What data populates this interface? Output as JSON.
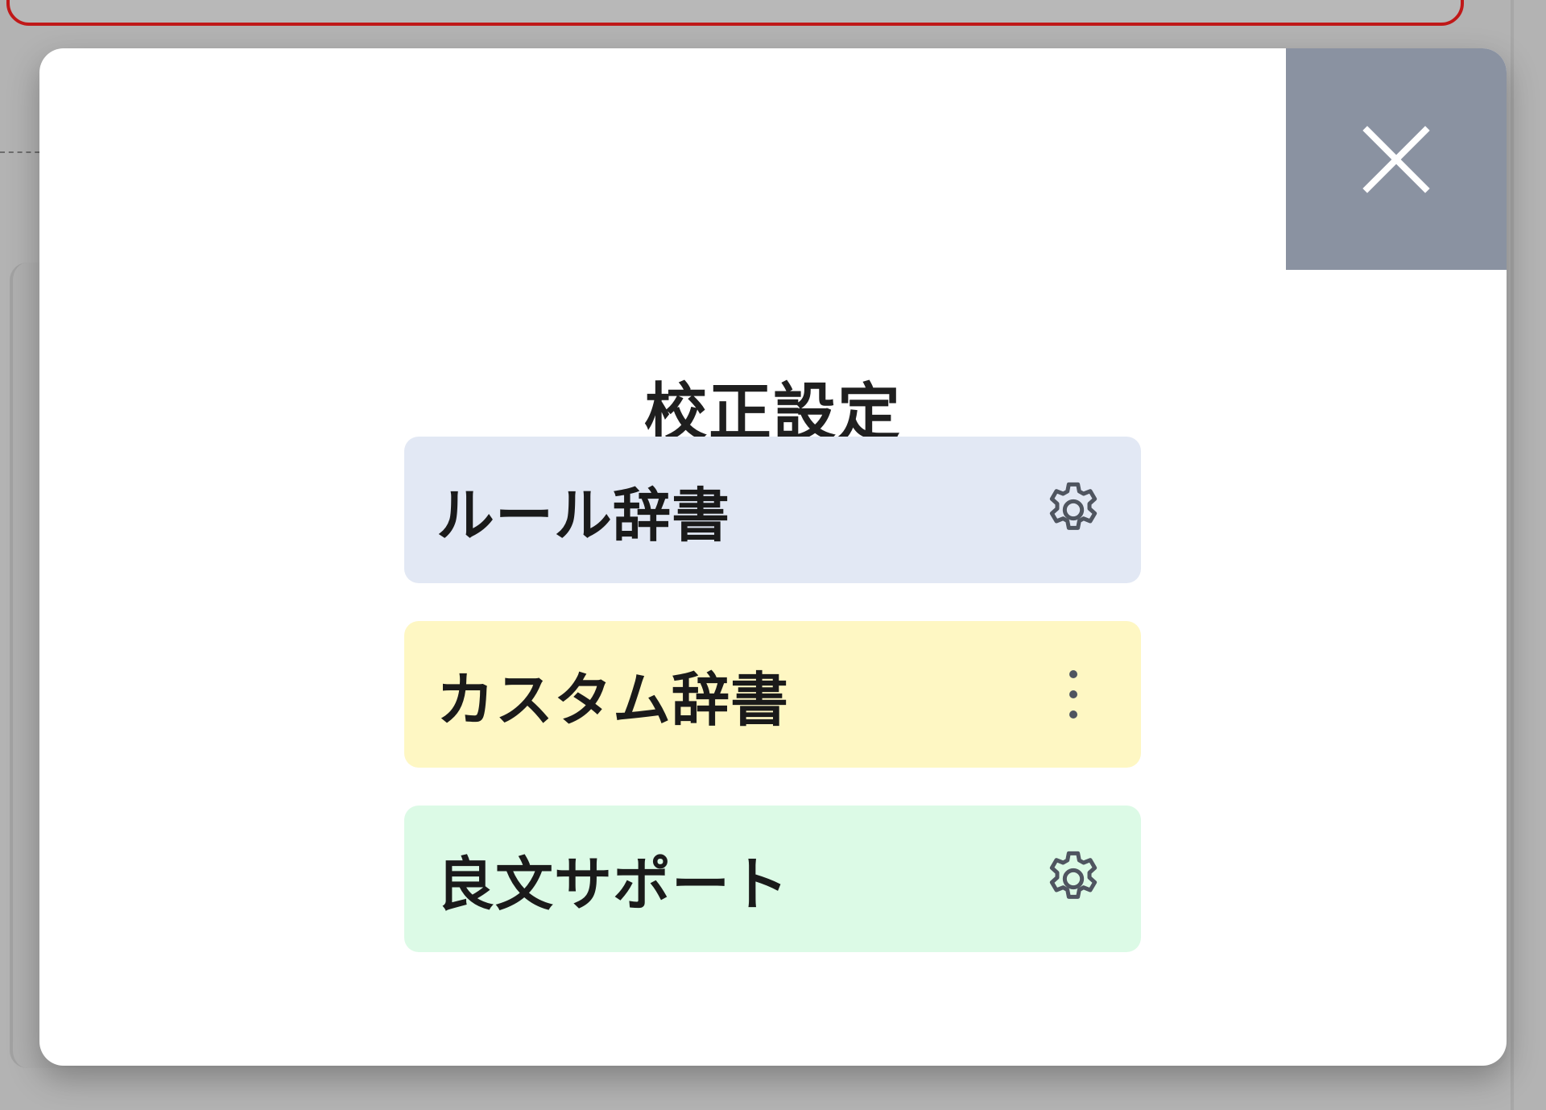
{
  "modal": {
    "title": "校正設定",
    "close_icon": "close-icon"
  },
  "settings": {
    "items": [
      {
        "label": "ルール辞書",
        "icon": "gear-icon",
        "bg": "#e2e8f4"
      },
      {
        "label": "カスタム辞書",
        "icon": "more-vertical-icon",
        "bg": "#fef7c3"
      },
      {
        "label": "良文サポート",
        "icon": "gear-icon",
        "bg": "#dcfae6"
      }
    ]
  },
  "colors": {
    "close_button_bg": "#8a92a1",
    "background_overlay": "#b3b3b3",
    "highlight_border": "#c01818"
  }
}
